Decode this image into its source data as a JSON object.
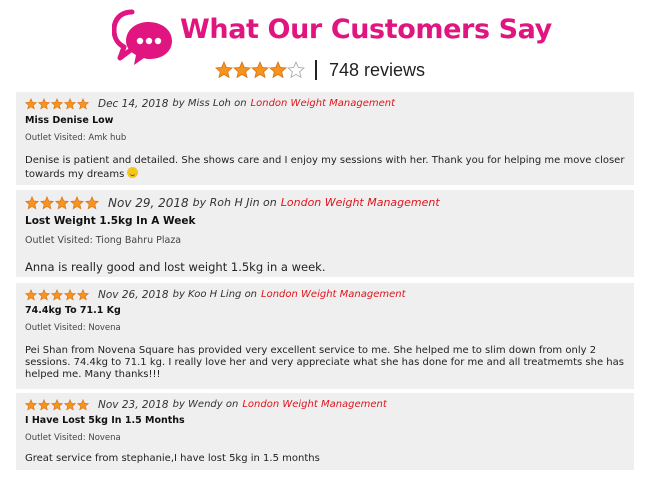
{
  "header": {
    "logo_icon": "speech-bubbles-icon",
    "title": "What Our Customers Say",
    "aggregate_stars": 4,
    "aggregate_max": 5,
    "review_count": "748 reviews",
    "brand_color": "#e0157f",
    "star_color": "#f7941d"
  },
  "reviews": [
    {
      "stars": 5,
      "date": "Dec 14, 2018",
      "by_text": "by Miss Loh on",
      "outlet_link": "London Weight Management",
      "title": "Miss Denise Low",
      "outlet_visited": "Outlet Visited: Amk hub",
      "body": "Denise is patient and detailed. She shows care and I enjoy my sessions with her. Thank you for helping me move closer towards my dreams",
      "emoji": "smiley-icon"
    },
    {
      "stars": 5,
      "date": "Nov 29, 2018",
      "by_text": "by Roh H Jin on",
      "outlet_link": "London Weight Management",
      "title": "Lost Weight 1.5kg In A Week",
      "outlet_visited": "Outlet Visited: Tiong Bahru Plaza",
      "body": "Anna is really good and lost weight 1.5kg in a week."
    },
    {
      "stars": 5,
      "date": "Nov 26, 2018",
      "by_text": "by Koo H Ling on",
      "outlet_link": "London Weight Management",
      "title": "74.4kg To 71.1 Kg",
      "outlet_visited": "Outlet Visited: Novena",
      "body": "Pei Shan from Novena Square has provided very excellent service to me. She helped me to slim down from only 2 sessions. 74.4kg to 71.1 kg. I really love her and very appreciate what she has done for me and all treatmemts she has helped me. Many thanks!!!"
    },
    {
      "stars": 5,
      "date": "Nov 23, 2018",
      "by_text": "by Wendy on",
      "outlet_link": "London Weight Management",
      "title": "I Have Lost 5kg In 1.5 Months",
      "outlet_visited": "Outlet Visited: Novena",
      "body": "Great service from stephanie,I have lost 5kg in 1.5 months"
    }
  ]
}
